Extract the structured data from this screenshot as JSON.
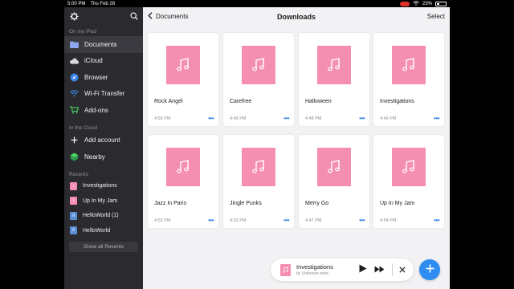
{
  "status_bar": {
    "time": "5:00 PM",
    "date": "Thu Feb 28",
    "battery": "23%"
  },
  "sidebar": {
    "sections": {
      "on_ipad": "On my iPad",
      "in_cloud": "In the Cloud",
      "recents": "Recents"
    },
    "on_ipad_items": [
      {
        "label": "Documents",
        "icon": "folder-icon"
      },
      {
        "label": "iCloud",
        "icon": "cloud-icon"
      },
      {
        "label": "Browser",
        "icon": "compass-icon"
      },
      {
        "label": "Wi-Fi Transfer",
        "icon": "wifi-icon"
      },
      {
        "label": "Add-ons",
        "icon": "cart-icon"
      }
    ],
    "cloud_items": [
      {
        "label": "Add account",
        "icon": "plus-icon"
      },
      {
        "label": "Nearby",
        "icon": "nearby-icon"
      }
    ],
    "recent_items": [
      {
        "label": "Investigations",
        "kind": "music"
      },
      {
        "label": "Up In My Jam",
        "kind": "music"
      },
      {
        "label": "HelloWorld (1)",
        "kind": "doc"
      },
      {
        "label": "HelloWorld",
        "kind": "doc"
      }
    ],
    "show_all_label": "Show all Recents"
  },
  "navbar": {
    "back_label": "Documents",
    "title": "Downloads",
    "select_label": "Select"
  },
  "files": [
    {
      "name": "Rock Angel",
      "time": "4:55 PM"
    },
    {
      "name": "Carefree",
      "time": "4:46 PM"
    },
    {
      "name": "Halloween",
      "time": "4:48 PM"
    },
    {
      "name": "Investigations",
      "time": "4:49 PM"
    },
    {
      "name": "Jazz In Paris",
      "time": "4:53 PM"
    },
    {
      "name": "Jingle Punks",
      "time": "4:52 PM"
    },
    {
      "name": "Merry Go",
      "time": "4:47 PM"
    },
    {
      "name": "Up In My Jam",
      "time": "4:54 PM"
    }
  ],
  "player": {
    "title": "Investigations",
    "artist": "by Unknown artist"
  },
  "colors": {
    "accent": "#2f8cf0",
    "music_art": "#f48fb1",
    "sidebar_bg": "#2b2b2f"
  }
}
